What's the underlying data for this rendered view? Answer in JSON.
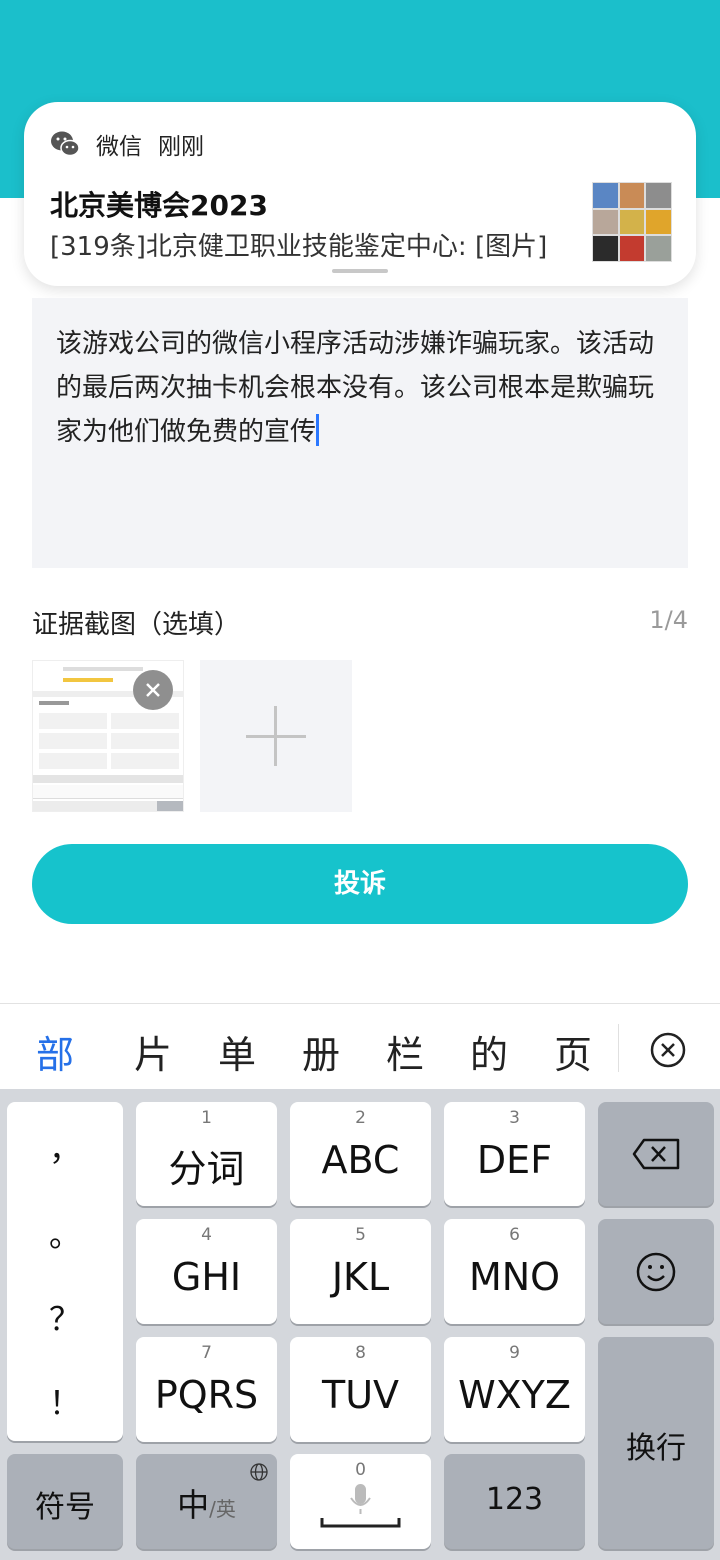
{
  "notification": {
    "app_name": "微信",
    "time": "刚刚",
    "title": "北京美博会2023",
    "body": "[319条]北京健卫职业技能鉴定中心: [图片]",
    "thumb_colors": [
      "#5a86c4",
      "#c98b56",
      "#8d8d8d",
      "#b8a79a",
      "#d3b24a",
      "#e0a52b",
      "#2b2b2b",
      "#c33b2f",
      "#9aa09a"
    ]
  },
  "complaint": {
    "text": "该游戏公司的微信小程序活动涉嫌诈骗玩家。该活动的最后两次抽卡机会根本没有。该公司根本是欺骗玩家为他们做免费的宣传"
  },
  "evidence": {
    "label": "证据截图（选填）",
    "count": "1/4"
  },
  "submit_label": "投诉",
  "candidates": [
    "部",
    "片",
    "单",
    "册",
    "栏",
    "的",
    "页"
  ],
  "keyboard": {
    "punctuation": [
      "，",
      "。",
      "？",
      "！"
    ],
    "keys": [
      {
        "num": "1",
        "label": "分词"
      },
      {
        "num": "2",
        "label": "ABC"
      },
      {
        "num": "3",
        "label": "DEF"
      },
      {
        "num": "4",
        "label": "GHI"
      },
      {
        "num": "5",
        "label": "JKL"
      },
      {
        "num": "6",
        "label": "MNO"
      },
      {
        "num": "7",
        "label": "PQRS"
      },
      {
        "num": "8",
        "label": "TUV"
      },
      {
        "num": "9",
        "label": "WXYZ"
      }
    ],
    "symbols_label": "符号",
    "lang_main": "中",
    "lang_alt": "/英",
    "space_num": "0",
    "numbers_label": "123",
    "enter_label": "换行"
  },
  "colors": {
    "accent": "#16c3cc",
    "candidate_highlight": "#2570e8"
  }
}
